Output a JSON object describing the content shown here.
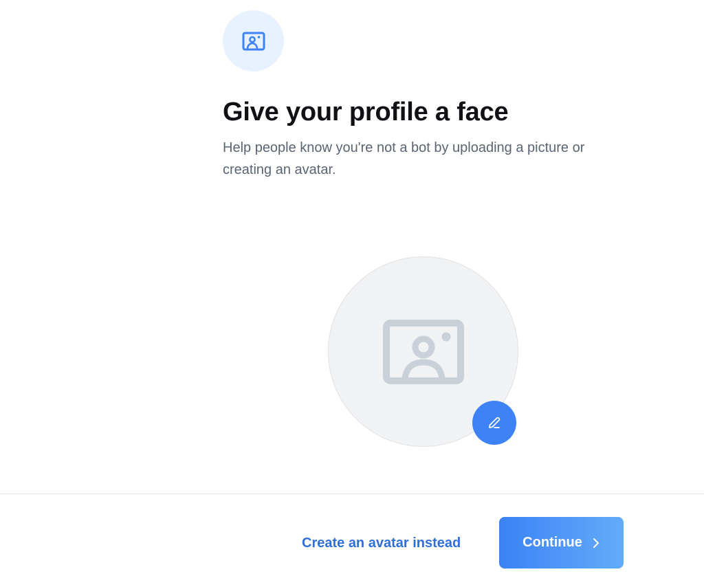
{
  "header": {
    "icon": "image-portrait-icon",
    "title": "Give your profile a face",
    "subtitle": "Help people know you're not a bot by uploading a picture or creating an avatar."
  },
  "avatar": {
    "placeholder_icon": "image-portrait-icon",
    "edit_icon": "pencil-icon"
  },
  "footer": {
    "secondary_label": "Create an avatar instead",
    "continue_label": "Continue",
    "continue_icon": "chevron-right-icon"
  },
  "colors": {
    "accent": "#3d82f6",
    "badge_bg": "#e8f1fe",
    "title_text": "#0f1115",
    "subtitle_text": "#5a6472",
    "placeholder_bg": "#f1f2f4",
    "placeholder_icon": "#c9d0d8",
    "link": "#2f6fd8"
  }
}
